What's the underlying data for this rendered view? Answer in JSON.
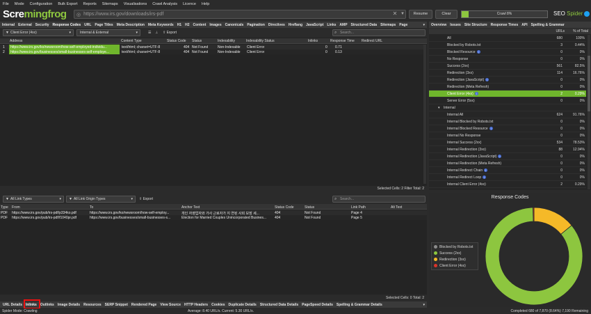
{
  "menu": [
    "File",
    "Mode",
    "Configuration",
    "Bulk Export",
    "Reports",
    "Sitemaps",
    "Visualisations",
    "Crawl Analysis",
    "Licence",
    "Help"
  ],
  "logo": {
    "a": "Scre",
    "b": "mingfrog"
  },
  "url": "https://www.irs.gov/downloads/irs-pdf",
  "buttons": {
    "resume": "Resume",
    "clear": "Clear"
  },
  "progress": {
    "label": "Crawl 8%",
    "value": 0.08
  },
  "brand": {
    "a": "SEO ",
    "b": "Spider"
  },
  "top_tabs": [
    "Internal",
    "External",
    "Security",
    "Response Codes",
    "URL",
    "Page Titles",
    "Meta Description",
    "Meta Keywords",
    "H1",
    "H2",
    "Content",
    "Images",
    "Canonicals",
    "Pagination",
    "Directives",
    "Hreflang",
    "JavaScript",
    "Links",
    "AMP",
    "Structured Data",
    "Sitemaps",
    "Page"
  ],
  "right_tabs": [
    "Overview",
    "Issues",
    "Site Structure",
    "Response Times",
    "API",
    "Spelling & Grammar"
  ],
  "top_filters": {
    "filter": "Client Error (4xx)",
    "scope": "Internal & External",
    "export": "Export",
    "search": "Search..."
  },
  "top_table": {
    "columns": [
      "Address",
      "Content Type",
      "Status Code",
      "Status",
      "Indexability",
      "Indexability Status",
      "Inlinks",
      "Response Time",
      "Redirect URL"
    ],
    "rows": [
      {
        "n": "1",
        "address": "https://www.irs.gov/ko/newsroom/how-self-employed-individu...",
        "ctype": "text/html; charset=UTF-8",
        "code": "404",
        "status": "Not Found",
        "idx": "Non-Indexable",
        "idxs": "Client Error",
        "inl": "0",
        "rt": "0.71"
      },
      {
        "n": "2",
        "address": "https://www.irs.gov/businesses/small-businesses-self-employe...",
        "ctype": "text/html; charset=UTF-8",
        "code": "404",
        "status": "Not Found",
        "idx": "Non-Indexable",
        "idxs": "Client Error",
        "inl": "0",
        "rt": "0.13"
      }
    ],
    "footer": "Selected Cells: 2  Filter Total: 2"
  },
  "bottom_filters": {
    "types": "All Link Types",
    "origin": "All Link Origin Types",
    "export": "Export",
    "search": "Search..."
  },
  "bottom_table": {
    "columns": [
      "Type",
      "From",
      "To",
      "Anchor Text",
      "Status Code",
      "Status",
      "Link Path",
      "Alt Text"
    ],
    "rows": [
      {
        "type": "PDF",
        "from": "https://www.irs.gov/pub/irs-pdf/p334ko.pdf",
        "to": "https://www.irs.gov/ko/newsroom/how-self-employ...",
        "anchor": "개인 자영업자와 가사 근로자가 지 연된 사회 보장 세...",
        "code": "404",
        "status": "Not Found",
        "path": "Page 4"
      },
      {
        "type": "PDF",
        "from": "https://www.irs.gov/pub/irs-pdf/f1040pr.pdf",
        "to": "https://www.irs.gov/businesses/small-businesses-s...",
        "anchor": "Election for Married Couples Unincorporated Busines...",
        "code": "404",
        "status": "Not Found",
        "path": "Page 5"
      }
    ],
    "footer": "Selected Cells: 0  Total: 2"
  },
  "bottom_tabs": [
    "URL Details",
    "Inlinks",
    "Outlinks",
    "Image Details",
    "Resources",
    "SERP Snippet",
    "Rendered Page",
    "View Source",
    "HTTP Headers",
    "Cookies",
    "Duplicate Details",
    "Structured Data Details",
    "PageSpeed Details",
    "Spelling & Grammar Details"
  ],
  "overview": {
    "columns": [
      "URLs",
      "% of Total"
    ],
    "rows": [
      {
        "name": "All",
        "urls": "680",
        "pct": "100%",
        "info": false
      },
      {
        "name": "Blocked by Robots.txt",
        "urls": "3",
        "pct": "0.44%",
        "info": false
      },
      {
        "name": "Blocked Resource",
        "urls": "0",
        "pct": "0%",
        "info": true
      },
      {
        "name": "No Response",
        "urls": "0",
        "pct": "0%",
        "info": false
      },
      {
        "name": "Success (2xx)",
        "urls": "561",
        "pct": "82.5%",
        "info": false
      },
      {
        "name": "Redirection (3xx)",
        "urls": "114",
        "pct": "16.76%",
        "info": false
      },
      {
        "name": "Redirection (JavaScript)",
        "urls": "0",
        "pct": "0%",
        "info": true
      },
      {
        "name": "Redirection (Meta Refresh)",
        "urls": "0",
        "pct": "0%",
        "info": false
      },
      {
        "name": "Client Error (4xx)",
        "urls": "2",
        "pct": "0.29%",
        "info": true,
        "selected": true
      },
      {
        "name": "Server Error (5xx)",
        "urls": "0",
        "pct": "0%",
        "info": false
      }
    ],
    "section": "Internal",
    "internal_rows": [
      {
        "name": "Internal All",
        "urls": "624",
        "pct": "91.76%",
        "info": false
      },
      {
        "name": "Internal Blocked by Robots.txt",
        "urls": "0",
        "pct": "0%",
        "info": false
      },
      {
        "name": "Internal Blocked Resource",
        "urls": "0",
        "pct": "0%",
        "info": true
      },
      {
        "name": "Internal No Response",
        "urls": "0",
        "pct": "0%",
        "info": false
      },
      {
        "name": "Internal Success (2xx)",
        "urls": "534",
        "pct": "78.53%",
        "info": false
      },
      {
        "name": "Internal Redirection (3xx)",
        "urls": "88",
        "pct": "12.94%",
        "info": false
      },
      {
        "name": "Internal Redirection (JavaScript)",
        "urls": "0",
        "pct": "0%",
        "info": true
      },
      {
        "name": "Internal Redirection (Meta Refresh)",
        "urls": "0",
        "pct": "0%",
        "info": false
      },
      {
        "name": "Internal Redirect Chain",
        "urls": "0",
        "pct": "0%",
        "info": true
      },
      {
        "name": "Internal Redirect Loop",
        "urls": "0",
        "pct": "0%",
        "info": true
      },
      {
        "name": "Internal Client Error (4xx)",
        "urls": "2",
        "pct": "0.29%",
        "info": false
      },
      {
        "name": "Internal Server Error (5xx)",
        "urls": "0",
        "pct": "0%",
        "info": false
      }
    ]
  },
  "chart_data": {
    "type": "pie",
    "title": "Response Codes",
    "categories": [
      "Blocked by Robots.txt",
      "Success (2xx)",
      "Redirection (3xx)",
      "Client Error (4xx)"
    ],
    "values": [
      0,
      534,
      88,
      2
    ],
    "colors": {
      "Blocked by Robots.txt": "#8c8c8c",
      "Success (2xx)": "#8dc63f",
      "Redirection (3xx)": "#f5b928",
      "Client Error (4xx)": "#d9342b"
    },
    "legend_position": "left"
  },
  "status": {
    "mode": "Spider Mode: Crawling",
    "speed": "Average: 8.40 URL/s. Current: 5.30 URL/s.",
    "completed": "Completed 680 of 7,870 (8.64%) 7,190 Remaining"
  }
}
